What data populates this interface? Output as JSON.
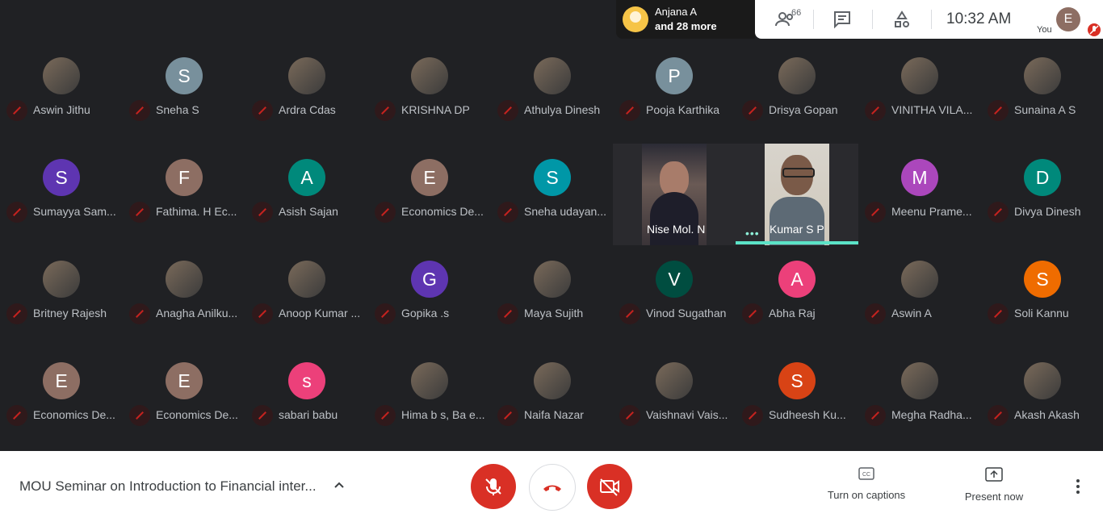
{
  "notification": {
    "line1": "Anjana A",
    "line2": "and 28 more"
  },
  "header": {
    "participants_count": "66",
    "time": "10:32  AM",
    "you_label": "You",
    "you_initial": "E"
  },
  "participants": [
    {
      "name": "Aswin Jithu",
      "initial": "",
      "color": "photo"
    },
    {
      "name": "Sneha S",
      "initial": "S",
      "color": "#78909c"
    },
    {
      "name": "Ardra Cdas",
      "initial": "",
      "color": "photo"
    },
    {
      "name": "KRISHNA DP",
      "initial": "",
      "color": "photo"
    },
    {
      "name": "Athulya Dinesh",
      "initial": "",
      "color": "photo"
    },
    {
      "name": "Pooja Karthika",
      "initial": "P",
      "color": "#78909c"
    },
    {
      "name": "Drisya Gopan",
      "initial": "",
      "color": "photo"
    },
    {
      "name": "VINITHA VILA...",
      "initial": "",
      "color": "photo"
    },
    {
      "name": "Sunaina A S",
      "initial": "",
      "color": "photo"
    },
    {
      "name": "Sumayya Sam...",
      "initial": "S",
      "color": "#5e35b1"
    },
    {
      "name": "Fathima. H Ec...",
      "initial": "F",
      "color": "#8d6e63"
    },
    {
      "name": "Asish Sajan",
      "initial": "A",
      "color": "#00897b"
    },
    {
      "name": "Economics De...",
      "initial": "E",
      "color": "#8d6e63"
    },
    {
      "name": "Sneha udayan...",
      "initial": "S",
      "color": "#0097a7"
    },
    {
      "name": "Meenu Prame...",
      "initial": "M",
      "color": "#ab47bc"
    },
    {
      "name": "Divya Dinesh",
      "initial": "D",
      "color": "#00897b"
    },
    {
      "name": "Britney Rajesh",
      "initial": "",
      "color": "photo"
    },
    {
      "name": "Anagha Anilku...",
      "initial": "",
      "color": "photo"
    },
    {
      "name": "Anoop Kumar ...",
      "initial": "",
      "color": "photo"
    },
    {
      "name": "Gopika .s",
      "initial": "G",
      "color": "#5e35b1"
    },
    {
      "name": "Maya Sujith",
      "initial": "",
      "color": "photo"
    },
    {
      "name": "Vinod Sugathan",
      "initial": "V",
      "color": "#004d40"
    },
    {
      "name": "Abha Raj",
      "initial": "A",
      "color": "#ec407a"
    },
    {
      "name": "Aswin A",
      "initial": "",
      "color": "photo"
    },
    {
      "name": "Soli Kannu",
      "initial": "S",
      "color": "#ef6c00"
    },
    {
      "name": "Economics De...",
      "initial": "E",
      "color": "#8d6e63"
    },
    {
      "name": "Economics De...",
      "initial": "E",
      "color": "#8d6e63"
    },
    {
      "name": "sabari babu",
      "initial": "s",
      "color": "#ec407a"
    },
    {
      "name": "Hima b s, Ba e...",
      "initial": "",
      "color": "photo"
    },
    {
      "name": "Naifa Nazar",
      "initial": "",
      "color": "photo"
    },
    {
      "name": "Vaishnavi Vais...",
      "initial": "",
      "color": "photo"
    },
    {
      "name": "Sudheesh Ku...",
      "initial": "S",
      "color": "#d84315"
    },
    {
      "name": "Megha Radha...",
      "initial": "",
      "color": "photo"
    },
    {
      "name": "Akash Akash",
      "initial": "",
      "color": "photo"
    }
  ],
  "videos": [
    {
      "name": "Nise Mol. N"
    },
    {
      "name": "Kumar S P"
    }
  ],
  "footer": {
    "meeting_title": "MOU Seminar on Introduction to Financial inter...",
    "captions_label": "Turn on captions",
    "present_label": "Present now"
  }
}
